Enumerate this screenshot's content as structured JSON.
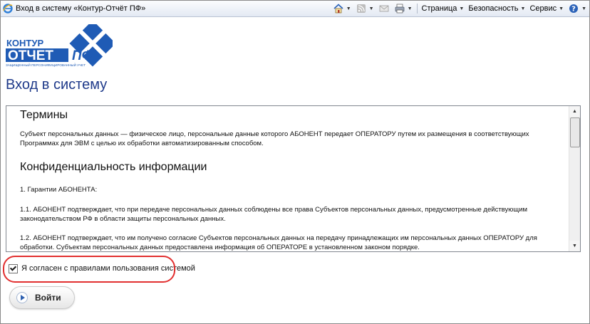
{
  "browser": {
    "tab_title": "Вход в систему «Контур-Отчёт ПФ»",
    "commands": {
      "page": "Страница",
      "safety": "Безопасность",
      "tools": "Сервис"
    },
    "icons": [
      "ie-icon",
      "home-icon",
      "rss-icon",
      "mail-icon",
      "print-icon",
      "help-icon"
    ]
  },
  "logo": {
    "line1": "КОНТУР",
    "line2": "ОТЧЕТ",
    "badge": "ПФ",
    "tagline": "ЗАЩИЩЕННЫЙ ПЕРСОНИФИЦИРОВАННЫЙ УЧЕТ"
  },
  "page_title": "Вход в систему",
  "terms": {
    "heading1": "Термины",
    "p1": "Субъект персональных данных — физическое лицо, персональные данные которого АБОНЕНТ передает ОПЕРАТОРУ путем их размещения в соответствующих Программах для ЭВМ с целью их обработки автоматизированным способом.",
    "heading2": "Конфиденциальность информации",
    "p2": "1. Гарантии АБОНЕНТА:",
    "p3": "1.1. АБОНЕНТ подтверждает, что при передаче персональных данных соблюдены все права Субъектов персональных данных, предусмотренные действующим законодательством РФ в области защиты персональных данных.",
    "p4": "1.2. АБОНЕНТ подтверждает, что им получено согласие Субъектов персональных данных на передачу принадлежащих им персональных данных ОПЕРАТОРУ для обработки. Субъектам персональных данных предоставлена информация об ОПЕРАТОРЕ в установленном законом порядке."
  },
  "agree": {
    "label": "Я согласен с правилами пользования системой",
    "checked": true
  },
  "login_button": "Войти",
  "colors": {
    "title": "#1f3a8a",
    "highlight": "#e23030",
    "logo_blue": "#1f5bb5"
  }
}
